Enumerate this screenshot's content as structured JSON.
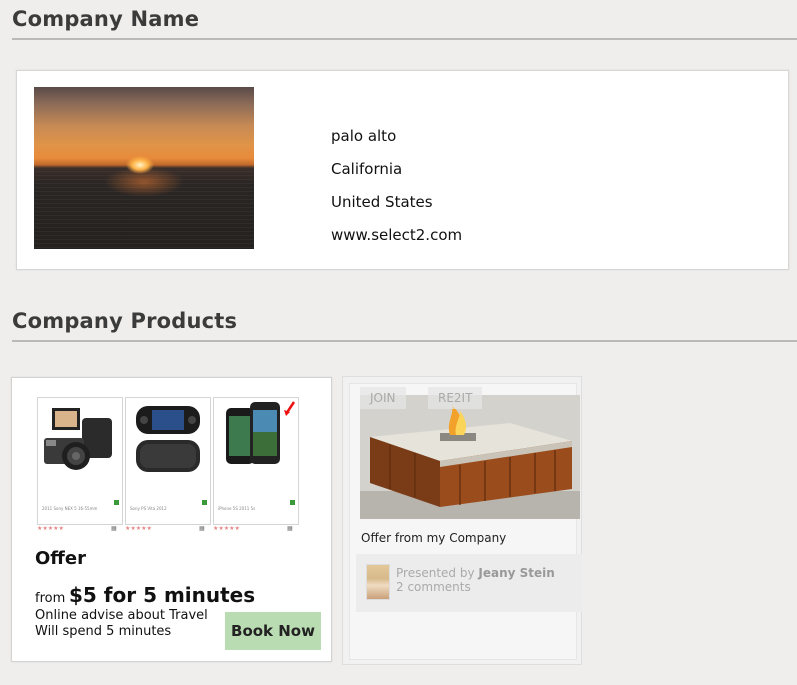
{
  "company": {
    "section_title": "Company Name",
    "city": "palo alto",
    "state": "California",
    "country": "United States",
    "website": "www.select2.com"
  },
  "products": {
    "section_title": "Company Products",
    "offer": {
      "thumbnails": [
        {
          "caption": "2011 Sony NEX 5 16-55mm",
          "icon": "camera-kit-image"
        },
        {
          "caption": "Sony PS Vita 2012",
          "icon": "handheld-console-image"
        },
        {
          "caption": "iPhone 5S 2011 5s",
          "icon": "smartphones-image"
        }
      ],
      "title": "Offer",
      "from_label": "from",
      "price": "$5 for 5 minutes",
      "desc_line1": "Online advise about Travel",
      "desc_line2": "Will spend 5 minutes",
      "book_label": "Book Now"
    },
    "card2": {
      "join_label": "JOIN",
      "re2it_label": "RE2IT",
      "caption": "Offer from my Company",
      "presented_prefix": "Presented by",
      "presenter": "Jeany Stein",
      "comments": "2 comments"
    }
  }
}
